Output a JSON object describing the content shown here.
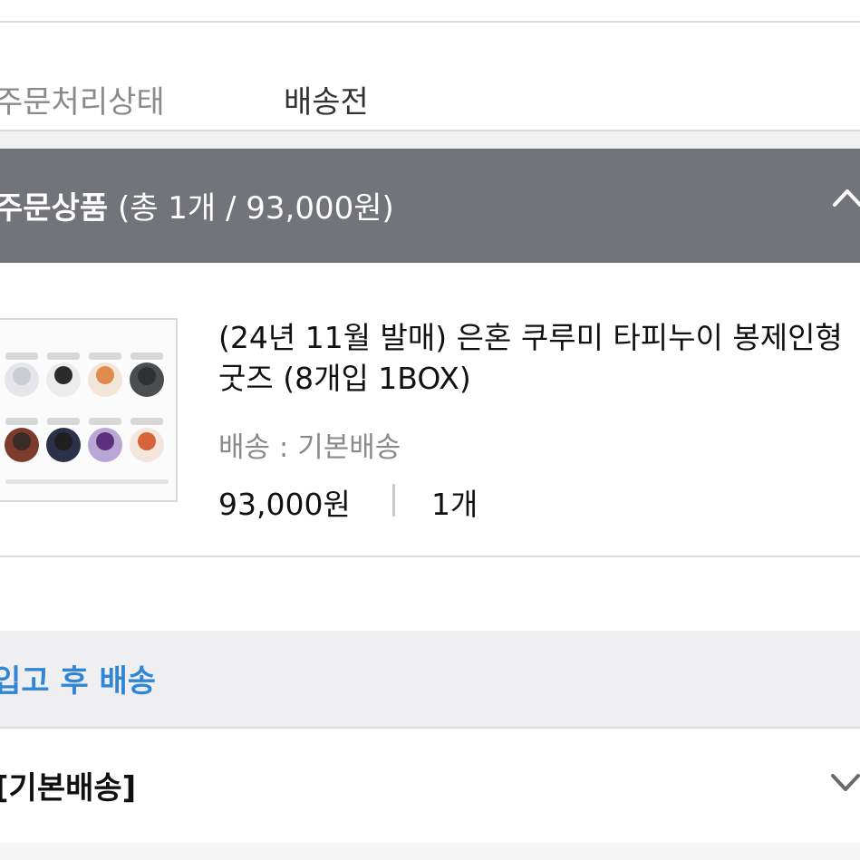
{
  "order_status": {
    "label": "주문처리상태",
    "value": "배송전"
  },
  "order_items": {
    "title": "주문상품",
    "summary": "(총 1개 / 93,000원)",
    "collapse_icon": "chevron-up-icon"
  },
  "product": {
    "name": "(24년 11월 발매) 은혼 쿠루미 타피누이 봉제인형 굿즈 (8개입 1BOX)",
    "shipping": "배송 : 기본배송",
    "price": "93,000원",
    "quantity": "1개"
  },
  "notice": {
    "text": "입고 후 배송"
  },
  "delivery": {
    "text": "[기본배송]",
    "expand_icon": "chevron-down-icon"
  },
  "colors": {
    "header_bg": "#727479",
    "notice_text": "#2f86d6"
  }
}
